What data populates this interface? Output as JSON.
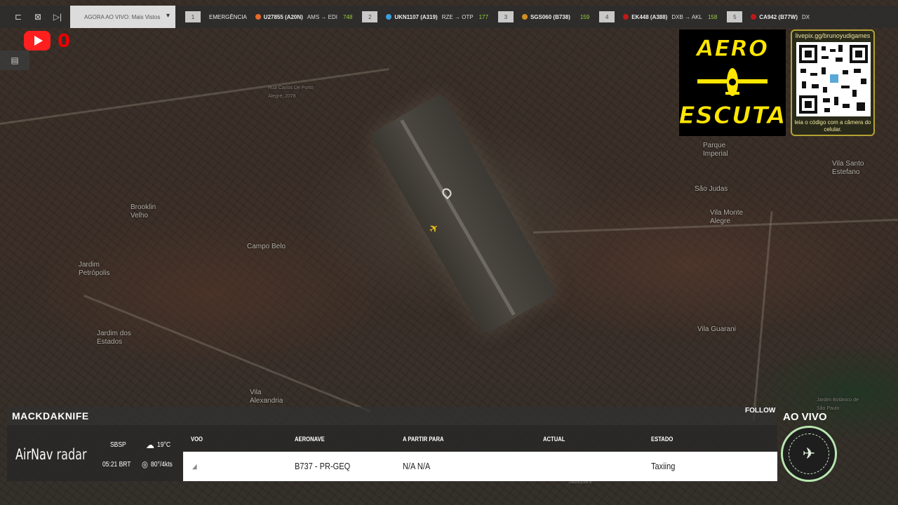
{
  "topbar": {
    "now_live": "AGORA AO VIVO: Mais Vistos",
    "emergency_label": "EMERGÊNCIA",
    "flights": [
      {
        "num": "1",
        "code": "U27855 (A20N)",
        "route": "AMS → EDI",
        "count": "748",
        "color": "#e86a2a"
      },
      {
        "num": "2",
        "code": "UKN1107 (A319)",
        "route": "RZE → OTP",
        "count": "177",
        "color": "#3aa0e0"
      },
      {
        "num": "3",
        "code": "SGS060 (B738)",
        "route": "",
        "count": "159",
        "color": "#d39020"
      },
      {
        "num": "4",
        "code": "EK448 (A388)",
        "route": "DXB → AKL",
        "count": "158",
        "color": "#c01818"
      },
      {
        "num": "5",
        "code": "CA942 (B77W)",
        "route": "DX",
        "count": "",
        "color": "#c01818"
      }
    ]
  },
  "youtube": {
    "count": "0"
  },
  "logo": {
    "line1": "AERO",
    "line2": "ESCUTA"
  },
  "qr": {
    "url": "livepix.gg/brunoyudigames",
    "caption": "leia o código com a câmera do celular."
  },
  "map_labels": [
    "Rua Carlos De Porto Alegre, 2078",
    "Brooklin Velho",
    "Campo Belo",
    "Jardim Petrópolis",
    "Jardim dos Estados",
    "Vila Alexandria",
    "Parque Imperial",
    "Vila Santo Estefano",
    "São Judas",
    "Vila Monte Alegre",
    "Vila Guarani",
    "Jardim Botânico de São Paulo",
    "Jabaquara"
  ],
  "panel": {
    "username": "MACKDAKNIFE",
    "follow": "FOLLOW",
    "brand_bold": "AirNav",
    "brand_thin": " radar",
    "airport": "SBSP",
    "time": "05:21 BRT",
    "temp": "19°C",
    "wind": "80°/4kts",
    "headers": {
      "flight": "VOO",
      "aircraft": "AERONAVE",
      "from_to": "A PARTIR PARA",
      "actual": "ACTUAL",
      "status": "ESTADO"
    },
    "row": {
      "aircraft": "B737 - PR-GEQ",
      "from_to": "N/A N/A",
      "actual": "",
      "status": "Taxiing"
    }
  },
  "live": {
    "label": "AO VIVO"
  }
}
